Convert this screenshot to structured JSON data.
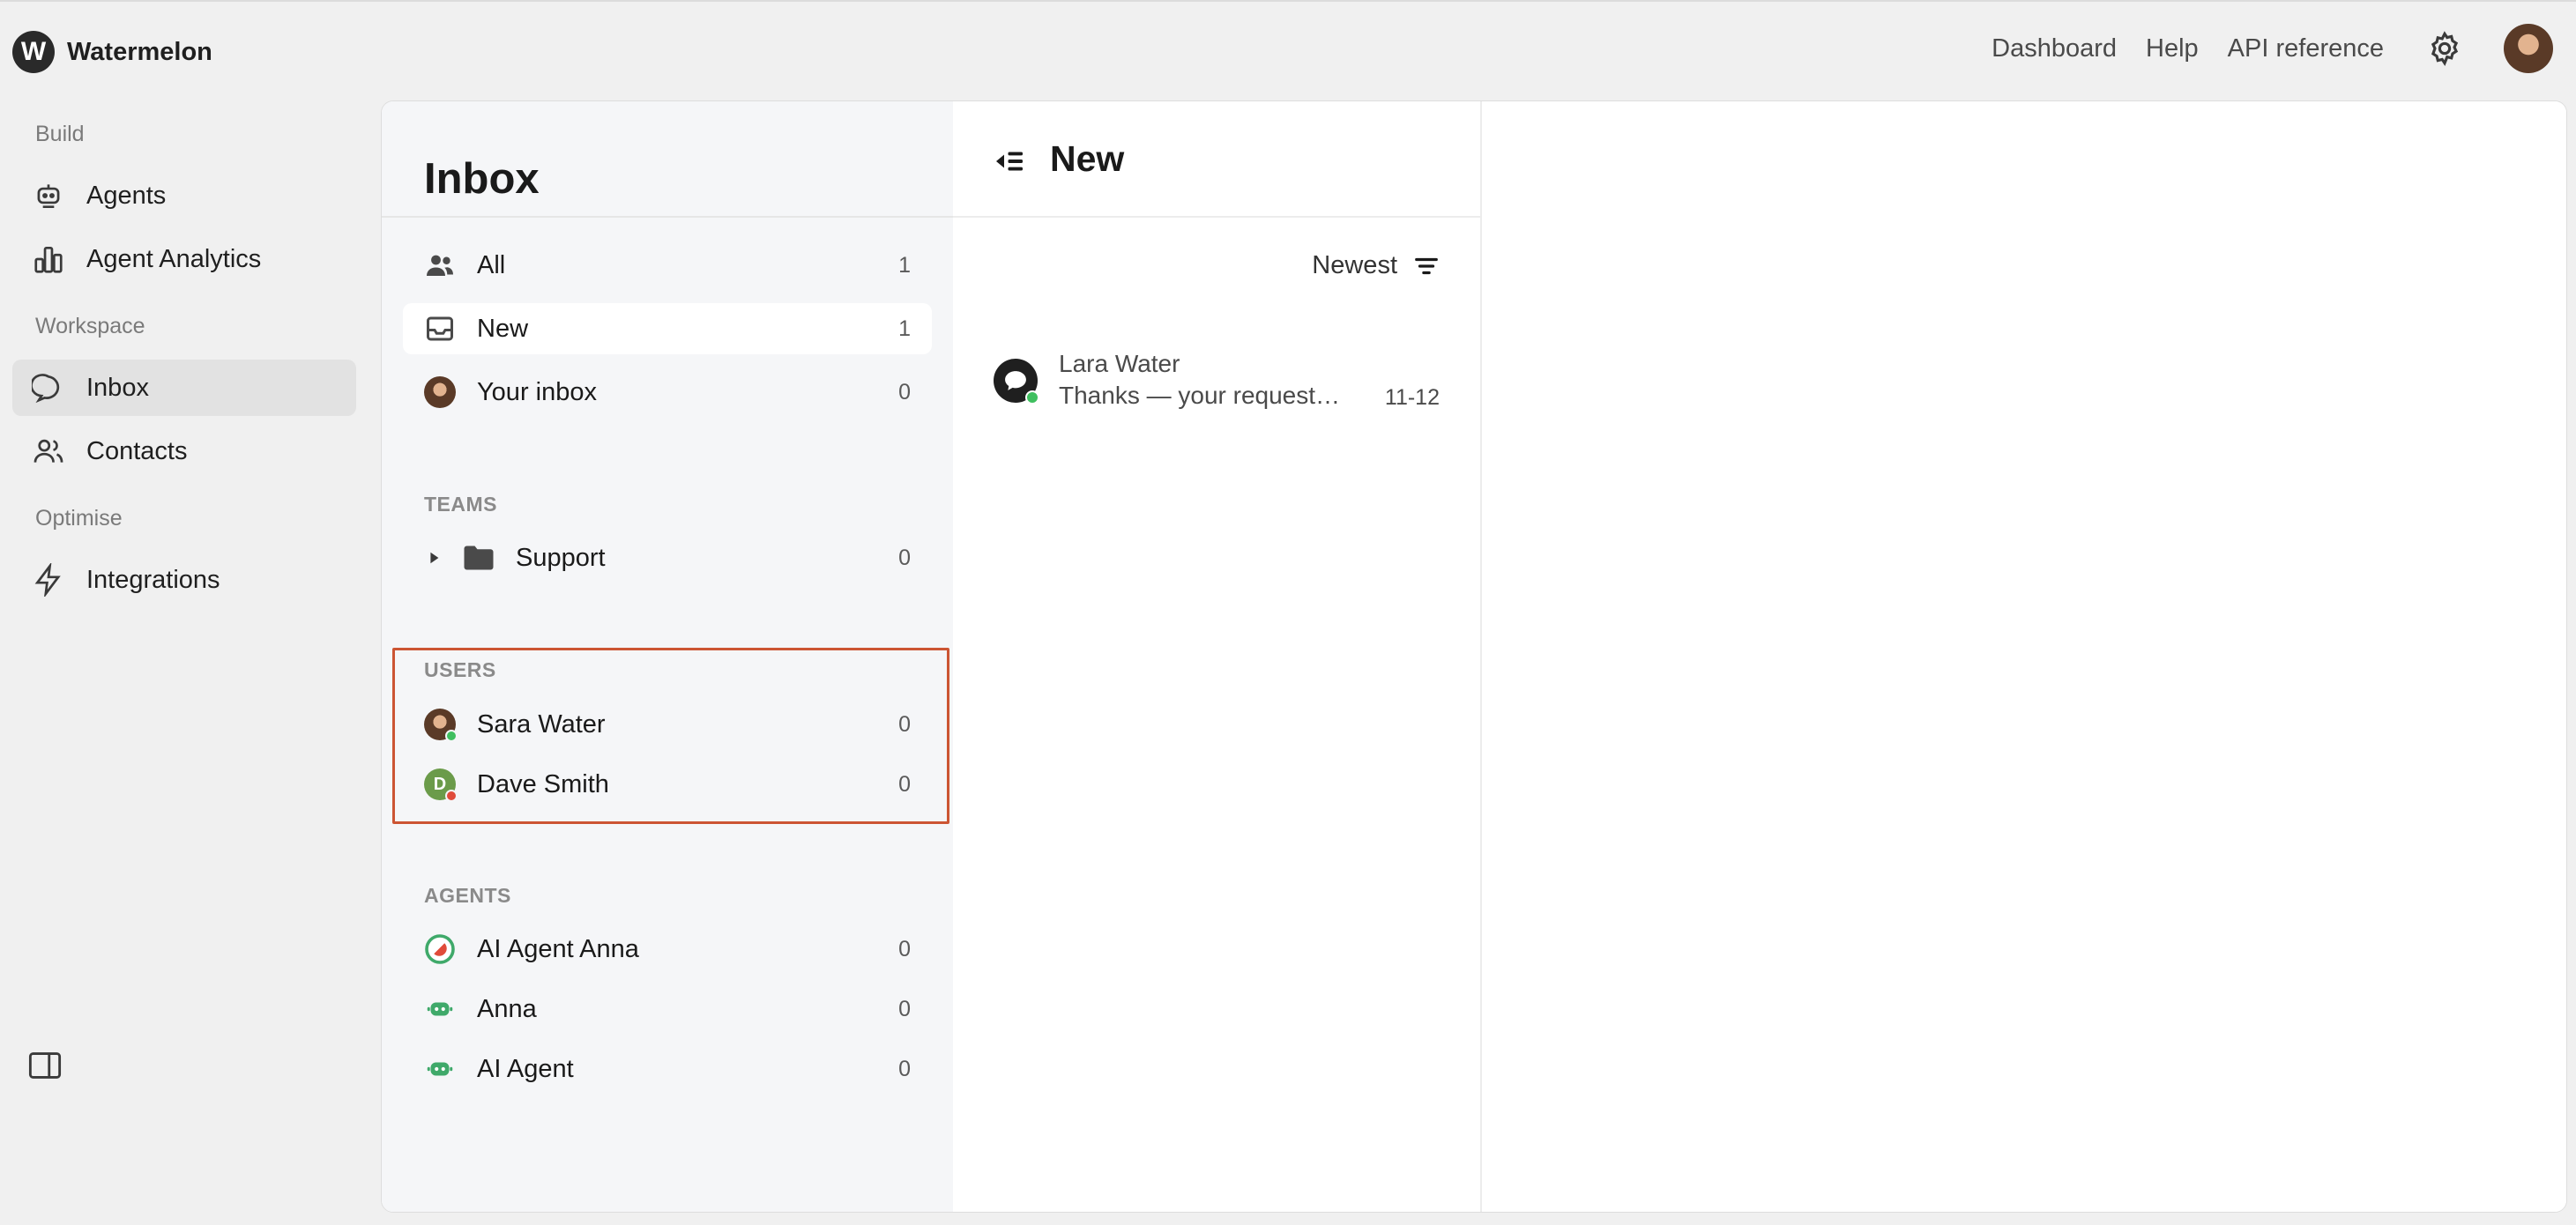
{
  "app": {
    "logo_letter": "W",
    "name": "Watermelon"
  },
  "topnav": {
    "dashboard": "Dashboard",
    "help": "Help",
    "api_reference": "API reference"
  },
  "sidebar": {
    "build_label": "Build",
    "workspace_label": "Workspace",
    "optimise_label": "Optimise",
    "items": {
      "agents": "Agents",
      "agent_analytics": "Agent Analytics",
      "inbox": "Inbox",
      "contacts": "Contacts",
      "integrations": "Integrations"
    }
  },
  "inbox": {
    "title": "Inbox",
    "views": [
      {
        "label": "All",
        "count": "1"
      },
      {
        "label": "New",
        "count": "1"
      },
      {
        "label": "Your inbox",
        "count": "0"
      }
    ],
    "teams_label": "TEAMS",
    "teams": [
      {
        "label": "Support",
        "count": "0"
      }
    ],
    "users_label": "USERS",
    "users": [
      {
        "label": "Sara Water",
        "count": "0",
        "status": "online"
      },
      {
        "label": "Dave Smith",
        "count": "0",
        "status": "busy",
        "initial": "D"
      }
    ],
    "agents_label": "AGENTS",
    "agents": [
      {
        "label": "AI Agent Anna",
        "count": "0"
      },
      {
        "label": "Anna",
        "count": "0"
      },
      {
        "label": "AI Agent",
        "count": "0"
      }
    ]
  },
  "list": {
    "title": "New",
    "sort_label": "Newest",
    "conversations": [
      {
        "name": "Lara Water",
        "preview": "Thanks — your request h...",
        "date": "11-12"
      }
    ]
  },
  "colors": {
    "highlight_border": "#cc5533",
    "online": "#3fbf5f",
    "busy": "#e04b3a",
    "agent_green": "#3fa96a"
  }
}
